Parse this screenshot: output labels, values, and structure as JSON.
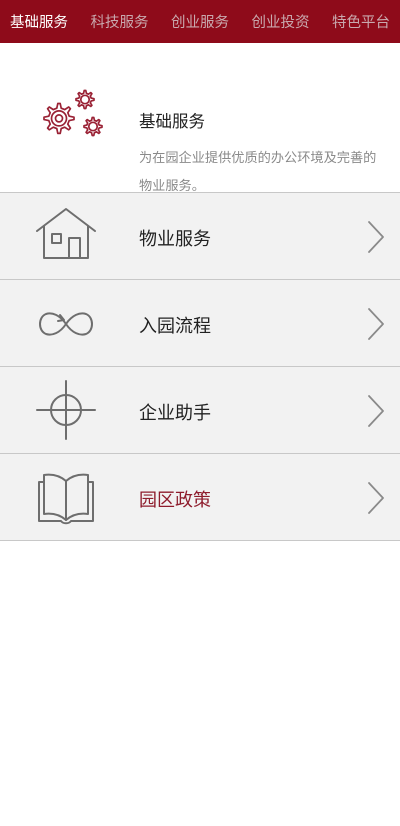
{
  "nav": {
    "tabs": [
      {
        "label": "基础服务",
        "active": true
      },
      {
        "label": "科技服务",
        "active": false
      },
      {
        "label": "创业服务",
        "active": false
      },
      {
        "label": "创业投资",
        "active": false
      },
      {
        "label": "特色平台",
        "active": false
      }
    ]
  },
  "intro": {
    "icon": "gears-icon",
    "title": "基础服务",
    "description": "为在园企业提供优质的办公环境及完善的物业服务。"
  },
  "menu": {
    "items": [
      {
        "label": "物业服务",
        "icon": "house-icon",
        "highlighted": false
      },
      {
        "label": "入园流程",
        "icon": "infinity-icon",
        "highlighted": false
      },
      {
        "label": "企业助手",
        "icon": "crosshair-icon",
        "highlighted": false
      },
      {
        "label": "园区政策",
        "icon": "book-icon",
        "highlighted": true
      }
    ]
  },
  "colors": {
    "nav_background": "#8e0b1a",
    "accent": "#8e1c2c",
    "item_background": "#f2f2f2"
  }
}
